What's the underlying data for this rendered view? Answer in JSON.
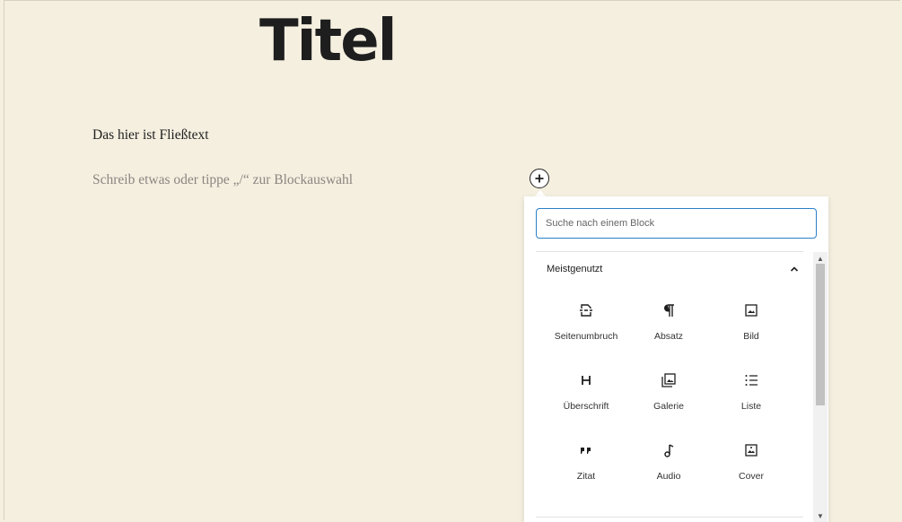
{
  "editor": {
    "title": "Titel",
    "paragraph": "Das hier ist Fließtext",
    "placeholder": "Schreib etwas oder tippe „/“ zur Blockauswahl"
  },
  "inserter": {
    "search_placeholder": "Suche nach einem Block",
    "category": "Meistgenutzt",
    "blocks": [
      {
        "label": "Seitenumbruch",
        "icon": "page-break-icon"
      },
      {
        "label": "Absatz",
        "icon": "paragraph-icon"
      },
      {
        "label": "Bild",
        "icon": "image-icon"
      },
      {
        "label": "Überschrift",
        "icon": "heading-icon"
      },
      {
        "label": "Galerie",
        "icon": "gallery-icon"
      },
      {
        "label": "Liste",
        "icon": "list-icon"
      },
      {
        "label": "Zitat",
        "icon": "quote-icon"
      },
      {
        "label": "Audio",
        "icon": "audio-icon"
      },
      {
        "label": "Cover",
        "icon": "cover-icon"
      }
    ]
  },
  "colors": {
    "background": "#f5efe0",
    "focus": "#2b80c9",
    "text": "#1e1e1e"
  }
}
